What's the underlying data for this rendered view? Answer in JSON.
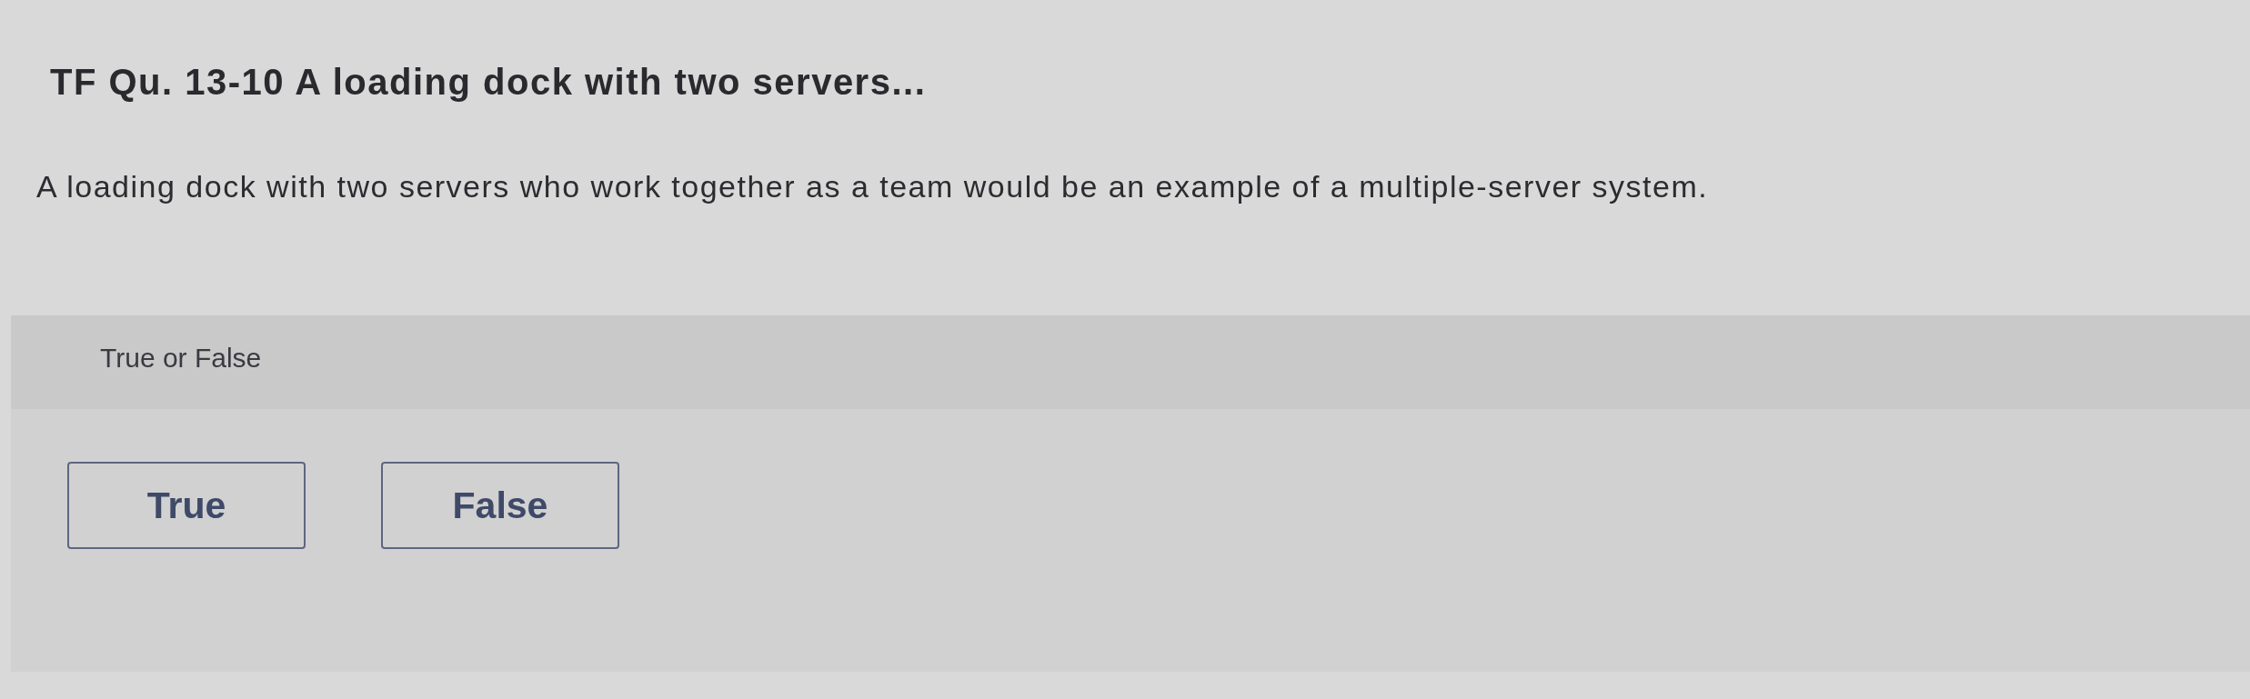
{
  "question": {
    "title": "TF Qu. 13-10 A loading dock with two servers...",
    "text": "A loading dock with two servers who work together as a team would be an example of a multiple-server system."
  },
  "answer": {
    "prompt": "True or False",
    "options": [
      {
        "label": "True",
        "selected": false
      },
      {
        "label": "False",
        "selected": false
      }
    ]
  }
}
